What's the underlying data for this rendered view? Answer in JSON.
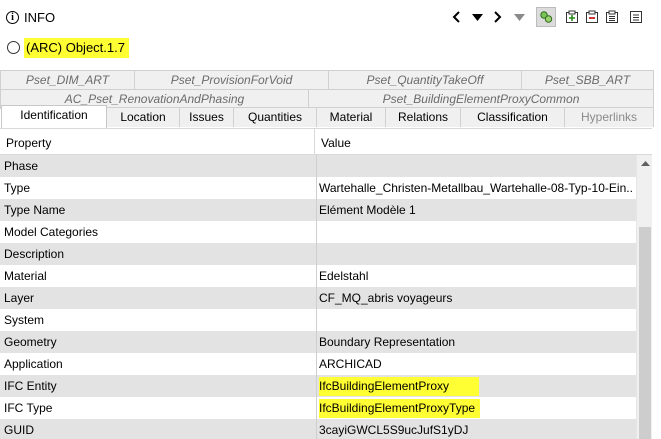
{
  "header": {
    "title": "INFO",
    "icons": [
      "info-icon",
      "prev-icon",
      "menu-down-icon",
      "next-icon",
      "next-menu-icon",
      "filter-icon",
      "add-icon",
      "remove-icon",
      "list-icon"
    ]
  },
  "object": {
    "label": "(ARC) Object.1.7"
  },
  "tabs": {
    "row1": [
      "Pset_DIM_ART",
      "Pset_ProvisionForVoid",
      "Pset_QuantityTakeOff",
      "Pset_SBB_ART"
    ],
    "row2": [
      "AC_Pset_RenovationAndPhasing",
      "Pset_BuildingElementProxyCommon"
    ],
    "row3": [
      "Identification",
      "Location",
      "Issues",
      "Quantities",
      "Material",
      "Relations",
      "Classification",
      "Hyperlinks"
    ]
  },
  "table": {
    "headers": {
      "property": "Property",
      "value": "Value"
    },
    "rows": [
      {
        "property": "Phase",
        "value": ""
      },
      {
        "property": "Type",
        "value": "Wartehalle_Christen-Metallbau_Wartehalle-08-Typ-10-Ein..."
      },
      {
        "property": "Type Name",
        "value": "Elément Modèle 1"
      },
      {
        "property": "Model Categories",
        "value": ""
      },
      {
        "property": "Description",
        "value": ""
      },
      {
        "property": "Material",
        "value": "Edelstahl"
      },
      {
        "property": "Layer",
        "value": "CF_MQ_abris voyageurs"
      },
      {
        "property": "System",
        "value": ""
      },
      {
        "property": "Geometry",
        "value": "Boundary Representation"
      },
      {
        "property": "Application",
        "value": "ARCHICAD"
      },
      {
        "property": "IFC Entity",
        "value": "IfcBuildingElementProxy"
      },
      {
        "property": "IFC Type",
        "value": "IfcBuildingElementProxyType"
      },
      {
        "property": "GUID",
        "value": "3cayiGWCL5S9ucJufS1yDJ"
      }
    ]
  },
  "colors": {
    "highlight": "#ffff33",
    "row_shade": "#e3e3e3",
    "tab_bg": "#f0f0f0"
  }
}
